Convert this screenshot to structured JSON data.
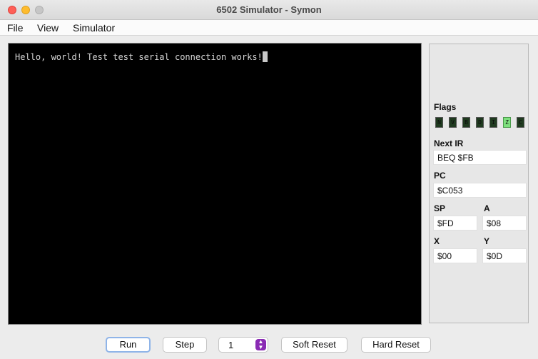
{
  "window": {
    "title": "6502 Simulator - Symon"
  },
  "menu": {
    "items": [
      "File",
      "View",
      "Simulator"
    ]
  },
  "console": {
    "text": "Hello, world! Test test serial connection works!"
  },
  "status": {
    "flags_label": "Flags",
    "flags": [
      {
        "name": "N",
        "active": false
      },
      {
        "name": "V",
        "active": false
      },
      {
        "name": "B",
        "active": false
      },
      {
        "name": "D",
        "active": false
      },
      {
        "name": "I",
        "active": false
      },
      {
        "name": "Z",
        "active": true
      },
      {
        "name": "C",
        "active": false
      }
    ],
    "next_ir_label": "Next IR",
    "next_ir": "BEQ $FB",
    "pc_label": "PC",
    "pc": "$C053",
    "sp_label": "SP",
    "sp": "$FD",
    "a_label": "A",
    "a": "$08",
    "x_label": "X",
    "x": "$00",
    "y_label": "Y",
    "y": "$0D"
  },
  "controls": {
    "run": "Run",
    "step": "Step",
    "step_count": "1",
    "soft_reset": "Soft Reset",
    "hard_reset": "Hard Reset"
  },
  "colors": {
    "flag_on": "#7ee07e",
    "flag_off": "#1f3a1f",
    "console_bg": "#000000"
  }
}
